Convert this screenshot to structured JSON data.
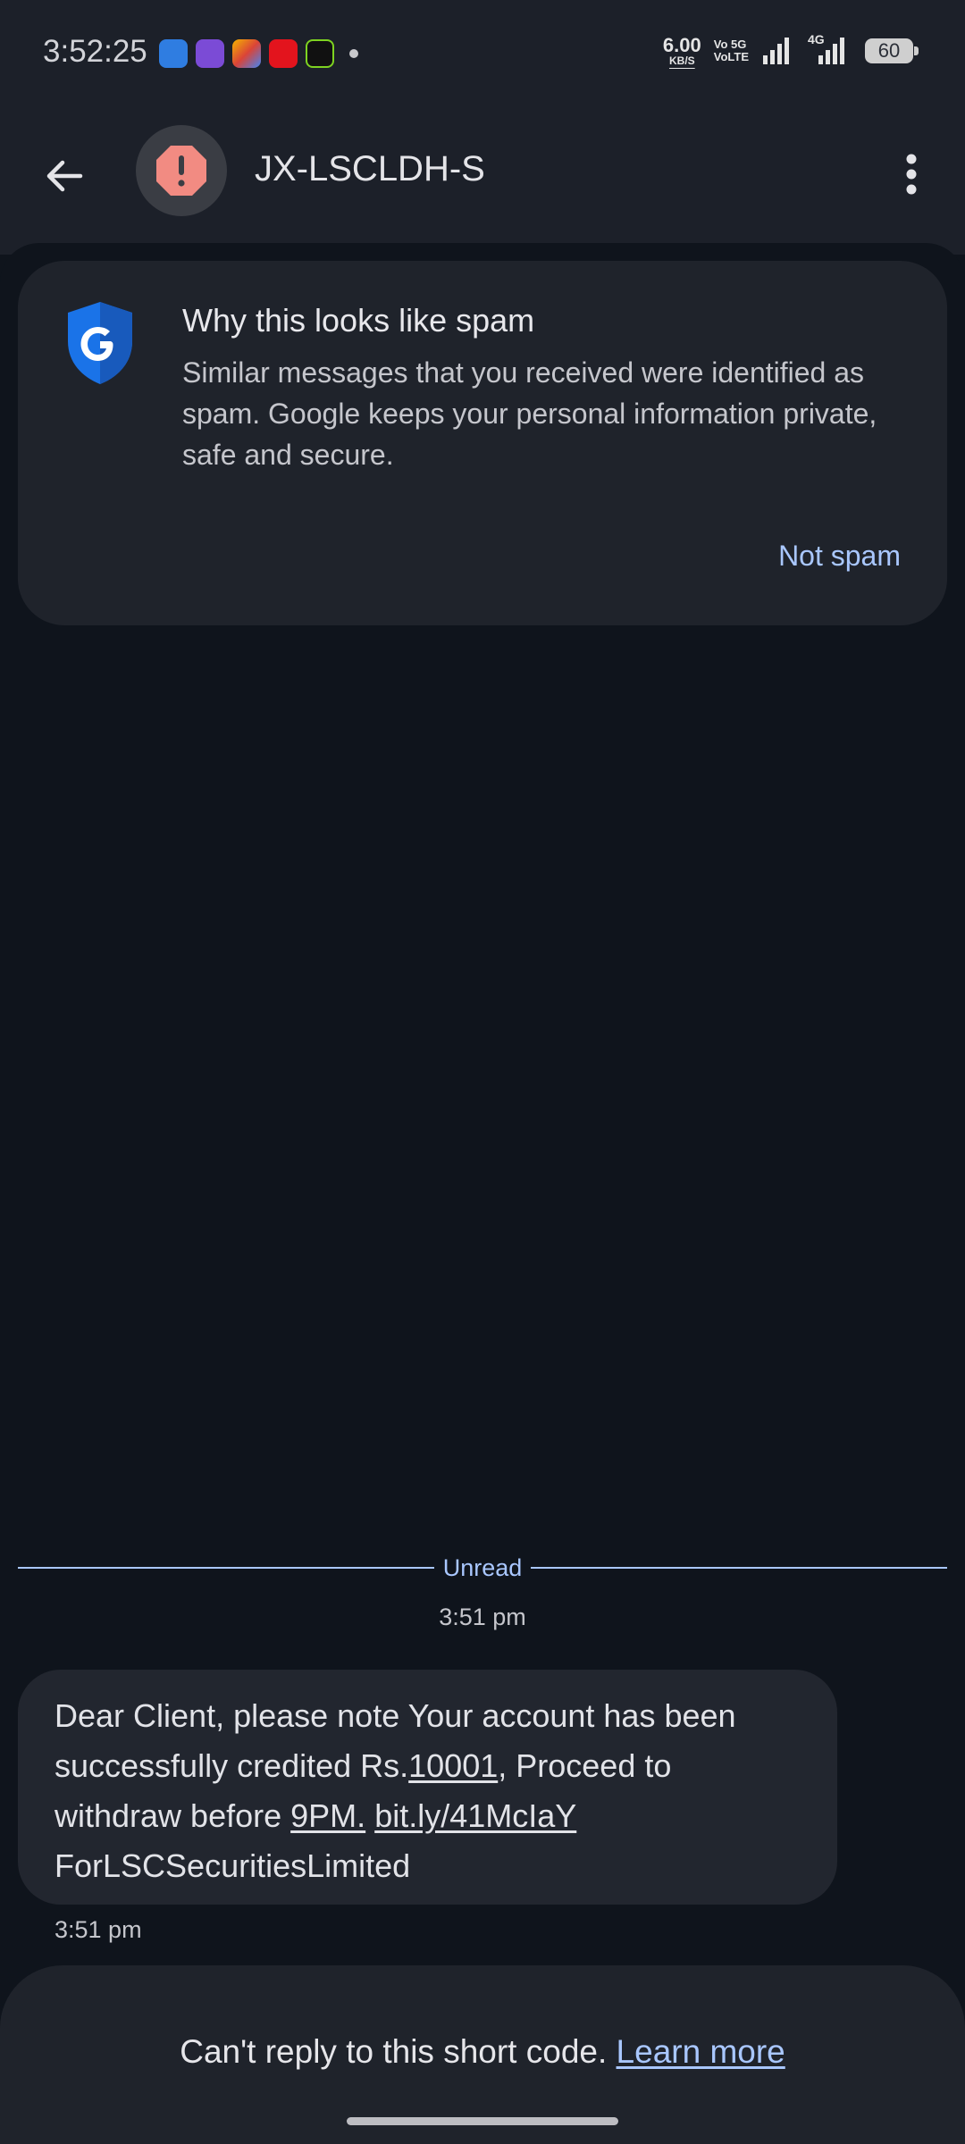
{
  "status_bar": {
    "time": "3:52:25",
    "net_speed_value": "6.00",
    "net_speed_unit": "KB/S",
    "volte_label_1": "Vo 5G",
    "volte_label_2": "VoLTE",
    "network_4g": "4G",
    "battery": "60"
  },
  "header": {
    "title": "JX-LSCLDH-S",
    "avatar_icon": "exclamation-icon"
  },
  "spam_card": {
    "title": "Why this looks like spam",
    "body": "Similar messages that you received were identified as spam. Google keeps your personal information private, safe and secure.",
    "action": "Not spam"
  },
  "conversation": {
    "divider_label": "Unread",
    "header_time": "3:51 pm",
    "message": {
      "part1": "Dear Client, please note Your account has been successfully credited Rs.",
      "amount": "10001",
      "part2": ", Proceed to withdraw before ",
      "time_link": "9PM.",
      "space": " ",
      "url": "bit.ly/41McIaY",
      "signature": "ForLSCSecuritiesLimited"
    },
    "message_time": "3:51 pm"
  },
  "reply": {
    "text": "Can't reply to this short code. ",
    "link": "Learn more"
  },
  "colors": {
    "accent": "#a9c7ff",
    "background": "#0f141c",
    "card": "#1f232b",
    "warning": "#f28b82"
  }
}
